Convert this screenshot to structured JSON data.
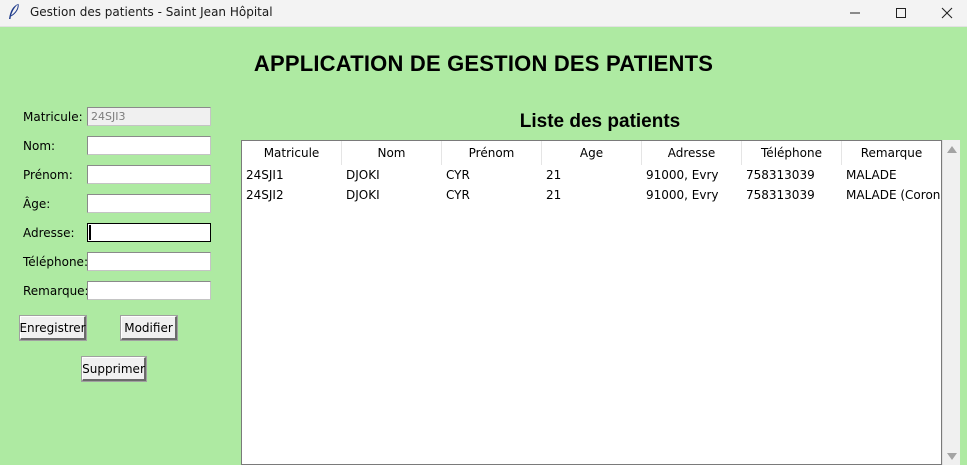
{
  "window": {
    "title": "Gestion des patients - Saint Jean Hôpital",
    "app_icon": "feather-icon"
  },
  "header": {
    "title": "APPLICATION DE GESTION DES PATIENTS"
  },
  "form": {
    "matricule_label": "Matricule:",
    "matricule_value": "24SJI3",
    "nom_label": "Nom:",
    "nom_value": "",
    "prenom_label": "Prénom:",
    "prenom_value": "",
    "age_label": "Âge:",
    "age_value": "",
    "adresse_label": "Adresse:",
    "adresse_value": "",
    "telephone_label": "Téléphone:",
    "telephone_value": "",
    "remarque_label": "Remarque:",
    "remarque_value": "",
    "save_label": "Enregistrer",
    "edit_label": "Modifier",
    "delete_label": "Supprimer"
  },
  "list": {
    "title": "Liste des patients",
    "columns": [
      "Matricule",
      "Nom",
      "Prénom",
      "Age",
      "Adresse",
      "Téléphone",
      "Remarque"
    ],
    "rows": [
      [
        "24SJI1",
        "DJOKI",
        "CYR",
        "21",
        "91000, Evry",
        "758313039",
        "MALADE"
      ],
      [
        "24SJI2",
        "DJOKI",
        "CYR",
        "21",
        "91000, Evry",
        "758313039",
        "MALADE (Corona"
      ]
    ]
  },
  "colors": {
    "background": "#aeeaa2",
    "titlebar": "#f3f3f3"
  }
}
